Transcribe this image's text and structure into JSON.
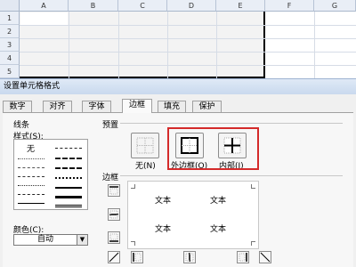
{
  "sheet": {
    "columns": [
      "A",
      "B",
      "C",
      "D",
      "E",
      "F",
      "G"
    ],
    "rows": [
      "1",
      "2",
      "3",
      "4",
      "5"
    ]
  },
  "dialog": {
    "title": "设置单元格格式",
    "tabs": [
      "数字",
      "对齐",
      "字体",
      "边框",
      "填充",
      "保护"
    ],
    "active_tab": "边框",
    "line_group": {
      "label": "线条",
      "style_label": "样式(S):",
      "none_label": "无",
      "color_label": "颜色(C):",
      "color_value": "自动"
    },
    "presets": {
      "label": "预置",
      "none": "无(N)",
      "outline": "外边框(O)",
      "inside": "内部(I)"
    },
    "border": {
      "label": "边框",
      "preview_text": [
        "文本",
        "文本",
        "文本",
        "文本"
      ]
    },
    "colors": {
      "highlight": "#d42a2a",
      "title_bar": "#c9d9ee"
    }
  }
}
